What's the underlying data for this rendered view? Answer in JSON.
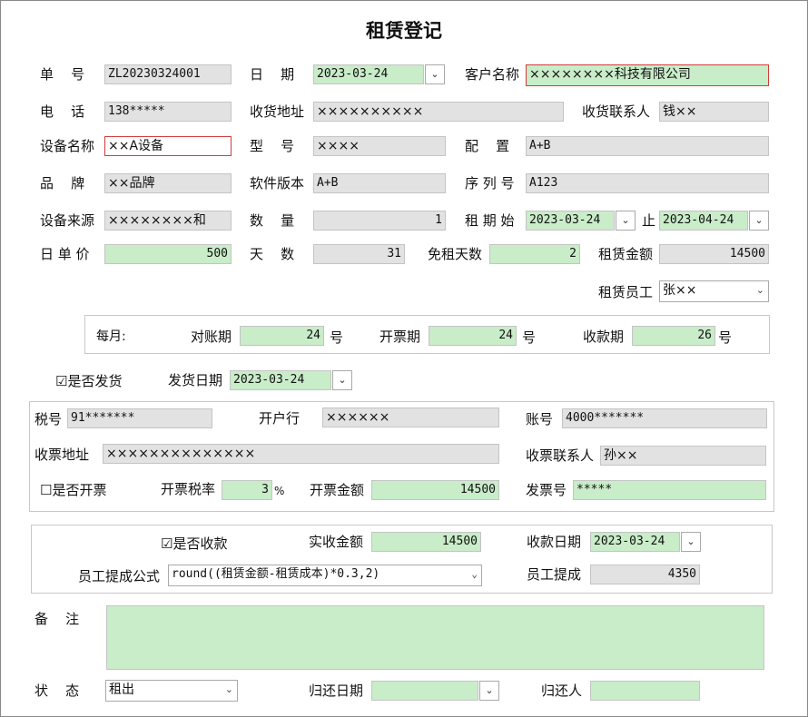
{
  "title": "租赁登记",
  "labels": {
    "order_no": "单    号",
    "date": "日    期",
    "customer": "客户名称",
    "phone": "电    话",
    "ship_addr": "收货地址",
    "ship_contact": "收货联系人",
    "device_name": "设备名称",
    "model": "型    号",
    "config": "配    置",
    "brand": "品    牌",
    "software": "软件版本",
    "serial": "序 列 号",
    "source": "设备来源",
    "qty": "数    量",
    "lease_start": "租 期 始",
    "lease_end": "止",
    "daily_price": "日 单 价",
    "days": "天    数",
    "free_days": "免租天数",
    "lease_amount": "租赁金额",
    "lease_staff": "租赁员工",
    "monthly": "每月:",
    "reconcile": "对账期",
    "invoice_period": "开票期",
    "collect_period": "收款期",
    "day_unit": "号",
    "shipped": "是否发货",
    "ship_date": "发货日期",
    "tax_no": "税号",
    "bank": "开户行",
    "account": "账号",
    "invoice_addr": "收票地址",
    "invoice_contact": "收票联系人",
    "invoiced": "是否开票",
    "tax_rate": "开票税率",
    "percent": "%",
    "invoice_amount": "开票金额",
    "invoice_no": "发票号",
    "collected": "是否收款",
    "received_amount": "实收金额",
    "collect_date": "收款日期",
    "commission_formula": "员工提成公式",
    "commission": "员工提成",
    "remark": "备    注",
    "status": "状    态",
    "return_date": "归还日期",
    "returner": "归还人"
  },
  "values": {
    "order_no": "ZL20230324001",
    "date": "2023-03-24",
    "customer": "××××××××科技有限公司",
    "phone": "138*****",
    "ship_addr": "××××××××××",
    "ship_contact": "钱××",
    "device_name": "××A设备",
    "model": "××××",
    "config": "A+B",
    "brand": "××品牌",
    "software": "A+B",
    "serial": "A123",
    "source": "××××××××和",
    "qty": "1",
    "lease_start": "2023-03-24",
    "lease_end": "2023-04-24",
    "daily_price": "500",
    "days": "31",
    "free_days": "2",
    "lease_amount": "14500",
    "lease_staff": "张××",
    "reconcile": "24",
    "invoice_period": "24",
    "collect_period": "26",
    "shipped_checked": "☑",
    "ship_date": "2023-03-24",
    "tax_no": "91*******",
    "bank": "××××××",
    "account": "4000*******",
    "invoice_addr": "××××××××××××××",
    "invoice_contact": "孙××",
    "invoiced_checked": "☐",
    "tax_rate": "3",
    "invoice_amount": "14500",
    "invoice_no": "*****",
    "collected_checked": "☑",
    "received_amount": "14500",
    "collect_date": "2023-03-24",
    "commission_formula": "round((租赁金额-租赁成本)*0.3,2)",
    "commission": "4350",
    "remark": "",
    "status": "租出",
    "return_date": "",
    "returner": ""
  },
  "icons": {
    "dropdown": "chevron-down-icon"
  }
}
